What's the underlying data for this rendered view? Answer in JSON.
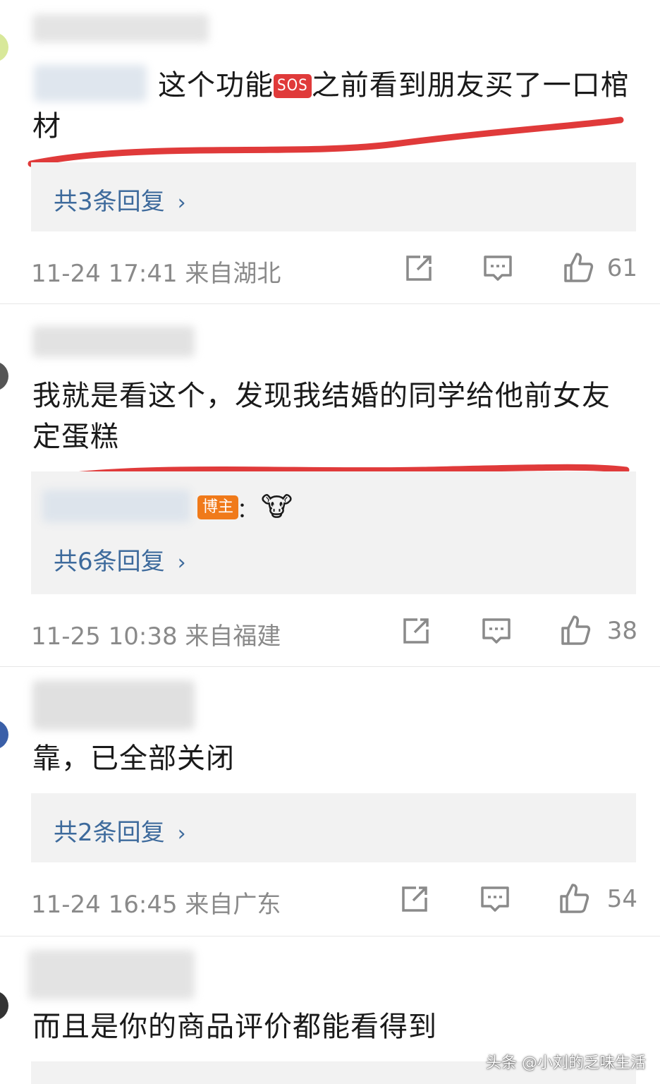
{
  "comments": [
    {
      "text_prefix": "这个功能",
      "emoji": "SOS",
      "text_suffix": "之前看到朋友买了一口棺材",
      "reply_count": "共3条回复",
      "time": "11-24 17:41 来自湖北",
      "likes": "61"
    },
    {
      "text": "我就是看这个，发现我结婚的同学给他前女友定蛋糕",
      "reply_badge": "博主",
      "reply_colon": "：",
      "reply_emoji": "🐮",
      "reply_count": "共6条回复",
      "time": "11-25 10:38 来自福建",
      "likes": "38"
    },
    {
      "text": "靠，已全部关闭",
      "reply_count": "共2条回复",
      "time": "11-24 16:45 来自广东",
      "likes": "54"
    },
    {
      "text": "而且是你的商品评价都能看得到"
    }
  ],
  "reply_chevron": "›",
  "icons": [
    "share-icon",
    "comment-icon",
    "like-icon"
  ],
  "colors": {
    "link_blue": "#3d6a9c",
    "meta_gray": "#8a8a8a",
    "annotation_red": "#e03a3a",
    "blogger_badge": "#f07a1a",
    "reply_bg": "#f2f2f2"
  },
  "watermark": "头条 @小刘的乏味生活"
}
